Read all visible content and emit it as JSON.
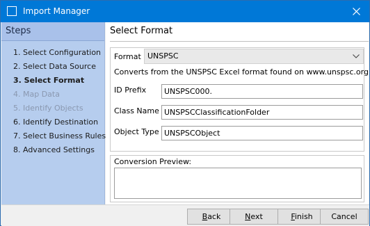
{
  "window": {
    "title": "Import Manager"
  },
  "steps": {
    "title": "Steps",
    "items": [
      {
        "label": "1. Select Configuration",
        "state": "normal"
      },
      {
        "label": "2. Select Data Source",
        "state": "normal"
      },
      {
        "label": "3. Select Format",
        "state": "active"
      },
      {
        "label": "4. Map Data",
        "state": "disabled"
      },
      {
        "label": "5. Identify Objects",
        "state": "disabled"
      },
      {
        "label": "6. Identify Destination",
        "state": "normal"
      },
      {
        "label": "7. Select Business Rules",
        "state": "normal"
      },
      {
        "label": "8. Advanced Settings",
        "state": "normal"
      }
    ]
  },
  "main": {
    "title": "Select Format",
    "format": {
      "label": "Format",
      "value": "UNSPSC",
      "description": "Converts from the UNSPSC Excel format found on www.unspsc.org"
    },
    "fields": [
      {
        "label": "ID Prefix",
        "value": "UNSPSC000."
      },
      {
        "label": "Class Name",
        "value": "UNSPSCClassificationFolder"
      },
      {
        "label": "Object Type",
        "value": "UNSPSCObject"
      }
    ],
    "preview": {
      "label": "Conversion Preview:",
      "value": ""
    }
  },
  "footer": {
    "back": {
      "mnemonic": "B",
      "rest": "ack"
    },
    "next": {
      "mnemonic": "N",
      "rest": "ext"
    },
    "finish": {
      "mnemonic": "F",
      "rest": "inish"
    },
    "cancel": "Cancel"
  },
  "colors": {
    "titlebar": "#0078d7",
    "steps_panel": "#b6cdee",
    "disabled_text": "#8a98b0"
  }
}
